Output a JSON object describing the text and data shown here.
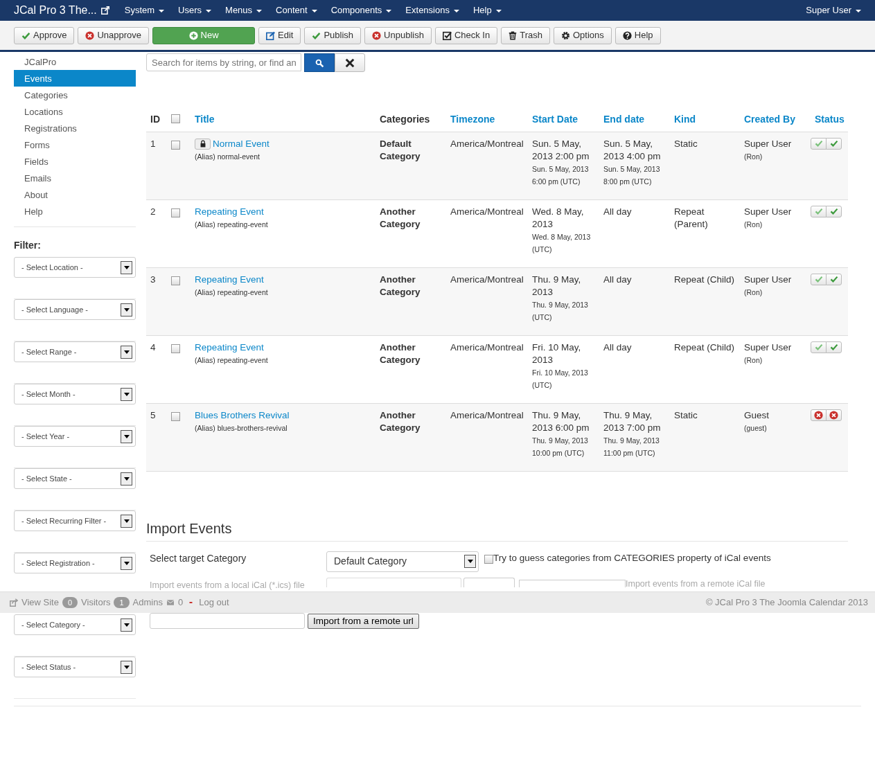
{
  "navbar": {
    "brand": "JCal Pro 3 The...",
    "menus": [
      "System",
      "Users",
      "Menus",
      "Content",
      "Components",
      "Extensions",
      "Help"
    ],
    "user_menu": "Super User"
  },
  "toolbar": [
    {
      "label": "Approve",
      "kind": "check"
    },
    {
      "label": "Unapprove",
      "kind": "cross"
    },
    {
      "label": "New",
      "kind": "new"
    },
    {
      "label": "Edit",
      "kind": "edit"
    },
    {
      "label": "Publish",
      "kind": "check"
    },
    {
      "label": "Unpublish",
      "kind": "cross"
    },
    {
      "label": "Check In",
      "kind": "checkin"
    },
    {
      "label": "Trash",
      "kind": "trash"
    },
    {
      "label": "Options",
      "kind": "gear"
    },
    {
      "label": "Help",
      "kind": "help"
    }
  ],
  "sidebar": {
    "items": [
      {
        "label": "JCalPro",
        "selected": false
      },
      {
        "label": "Events",
        "selected": true
      },
      {
        "label": "Categories",
        "selected": false
      },
      {
        "label": "Locations",
        "selected": false
      },
      {
        "label": "Registrations",
        "selected": false
      },
      {
        "label": "Forms",
        "selected": false
      },
      {
        "label": "Fields",
        "selected": false
      },
      {
        "label": "Emails",
        "selected": false
      },
      {
        "label": "About",
        "selected": false
      },
      {
        "label": "Help",
        "selected": false
      }
    ],
    "filter_label": "Filter:",
    "filters": [
      "- Select Location -",
      "- Select Language -",
      "- Select Range -",
      "- Select Month -",
      "- Select Year -",
      "- Select State -",
      "- Select Recurring Filter -",
      "- Select Registration -",
      "- Select Category -",
      "- Select Status -"
    ]
  },
  "search": {
    "placeholder": "Search for items by string, or find an"
  },
  "table": {
    "select_all_checked": false,
    "columns": [
      {
        "label": "ID",
        "sortable": false
      },
      {
        "label": "Title",
        "sortable": true
      },
      {
        "label": "Categories",
        "sortable": false
      },
      {
        "label": "Timezone",
        "sortable": true
      },
      {
        "label": "Start Date",
        "sortable": true
      },
      {
        "label": "End date",
        "sortable": true
      },
      {
        "label": "Kind",
        "sortable": true
      },
      {
        "label": "Created By",
        "sortable": true
      },
      {
        "label": "Status",
        "sortable": true
      }
    ],
    "rows": [
      {
        "id": "1",
        "checked": false,
        "locked": true,
        "title": "Normal Event",
        "alias": "(Alias) normal-event",
        "category": "Default Category",
        "timezone": "America/Montreal",
        "start": "Sun. 5 May, 2013 2:00 pm",
        "start_utc": "Sun. 5 May, 2013 6:00 pm (UTC)",
        "end": "Sun. 5 May, 2013 4:00 pm",
        "end_utc": "Sun. 5 May, 2013 8:00 pm (UTC)",
        "kind": "Static",
        "created_by": "Super User",
        "username": "(Ron)",
        "approved": true,
        "published": true
      },
      {
        "id": "2",
        "checked": false,
        "locked": false,
        "title": "Repeating Event",
        "alias": "(Alias) repeating-event",
        "category": "Another Category",
        "timezone": "America/Montreal",
        "start": "Wed. 8 May, 2013",
        "start_utc": "Wed. 8 May, 2013 (UTC)",
        "end": "All day",
        "kind": "Repeat (Parent)",
        "created_by": "Super User",
        "username": "(Ron)",
        "approved": true,
        "published": true
      },
      {
        "id": "3",
        "checked": false,
        "locked": false,
        "title": "Repeating Event",
        "alias": "(Alias) repeating-event",
        "category": "Another Category",
        "timezone": "America/Montreal",
        "start": "Thu. 9 May, 2013",
        "start_utc": "Thu. 9 May, 2013 (UTC)",
        "end": "All day",
        "kind": "Repeat (Child)",
        "created_by": "Super User",
        "username": "(Ron)",
        "approved": true,
        "published": true
      },
      {
        "id": "4",
        "checked": false,
        "locked": false,
        "title": "Repeating Event",
        "alias": "(Alias) repeating-event",
        "category": "Another Category",
        "timezone": "America/Montreal",
        "start": "Fri. 10 May, 2013",
        "start_utc": "Fri. 10 May, 2013 (UTC)",
        "end": "All day",
        "kind": "Repeat (Child)",
        "created_by": "Super User",
        "username": "(Ron)",
        "approved": true,
        "published": true
      },
      {
        "id": "5",
        "checked": false,
        "locked": false,
        "title": "Blues Brothers Revival",
        "alias": "(Alias) blues-brothers-revival",
        "category": "Another Category",
        "timezone": "America/Montreal",
        "start": "Thu. 9 May, 2013 6:00 pm",
        "start_utc": "Thu. 9 May, 2013 10:00 pm (UTC)",
        "end": "Thu. 9 May, 2013 7:00 pm",
        "end_utc": "Thu. 9 May, 2013 11:00 pm (UTC)",
        "kind": "Static",
        "created_by": "Guest",
        "username": "(guest)",
        "approved": false,
        "published": false
      }
    ]
  },
  "import": {
    "title": "Import Events",
    "target_label": "Select target Category",
    "target_value": "Default Category",
    "guess_checked": false,
    "guess_label": "Try to guess categories from CATEGORIES property of iCal events",
    "local_label": "Import events from a local iCal (*.ics) file",
    "remote_label": "Import events from a remote iCal file",
    "remote_button": "Import from a remote url"
  },
  "status_bar": {
    "view_site": "View Site",
    "visitors_count": "0",
    "visitors": "Visitors",
    "admins_count": "1",
    "admins": "Admins",
    "messages": "0",
    "logout": "Log out",
    "copyright": "© JCal Pro 3 The Joomla Calendar 2013"
  }
}
